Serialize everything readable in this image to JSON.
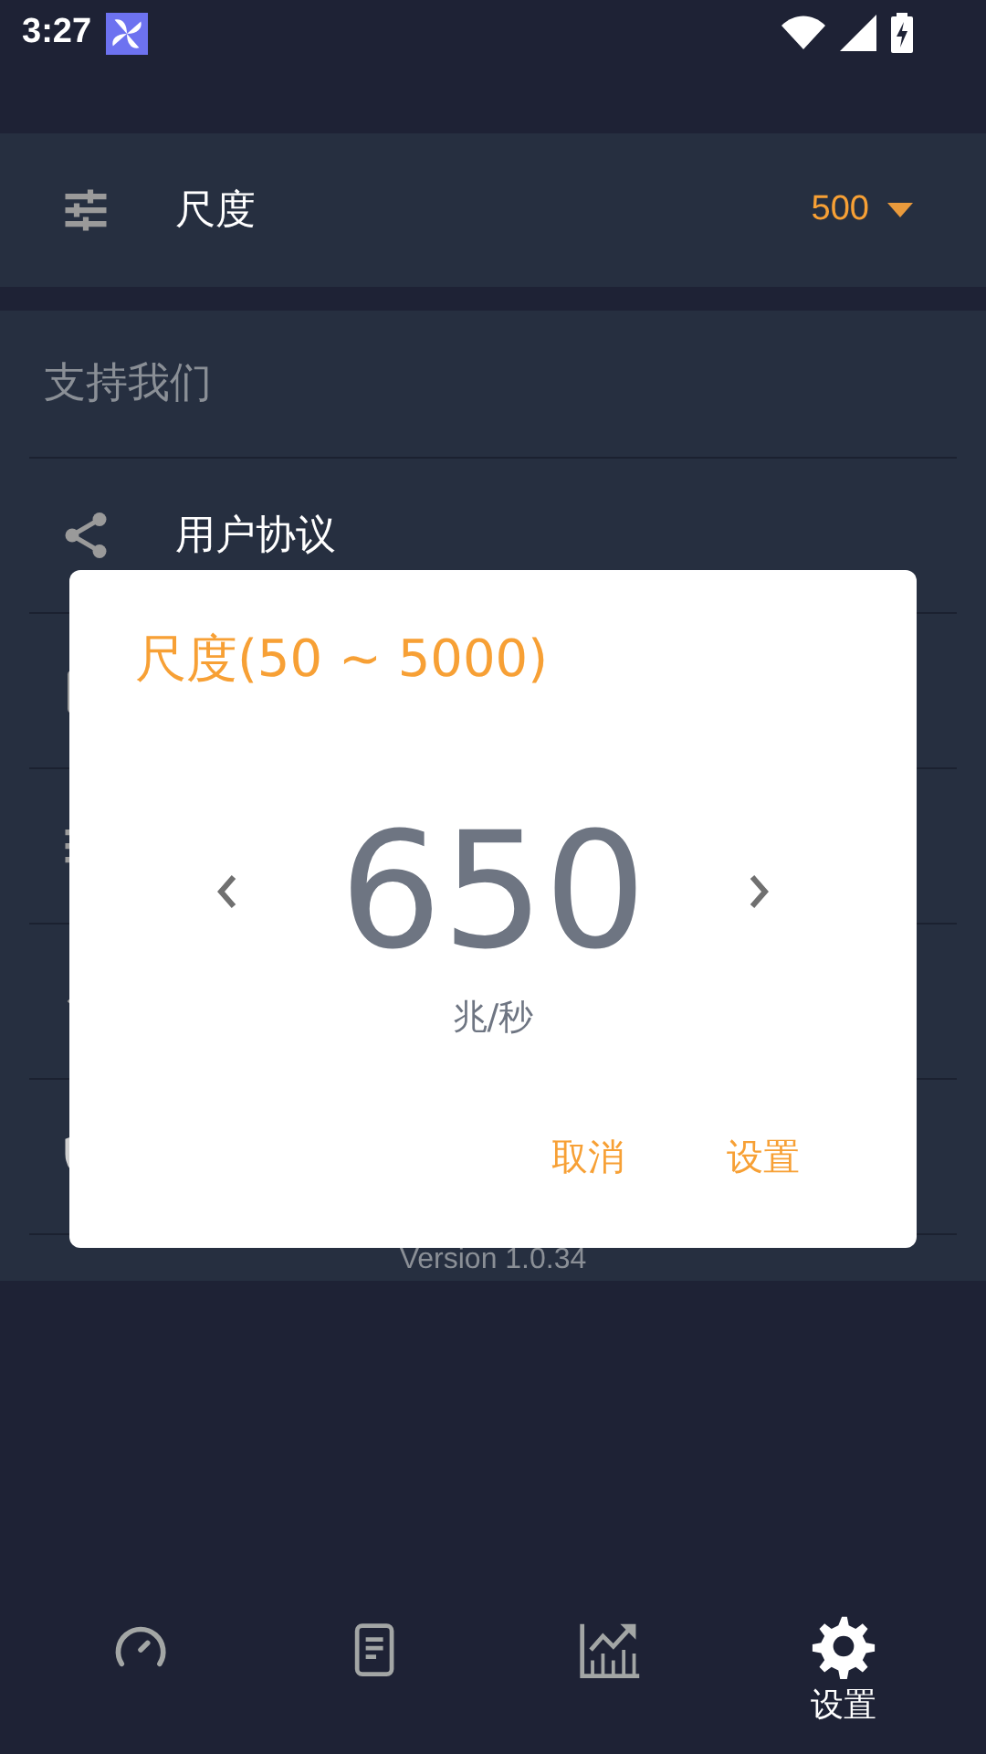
{
  "status_bar": {
    "time": "3:27"
  },
  "scale_setting": {
    "label": "尺度",
    "value": "500"
  },
  "support_section": {
    "header": "支持我们",
    "items": [
      {
        "label": "用户协议"
      }
    ]
  },
  "version": "Version 1.0.34",
  "dialog": {
    "title": "尺度(50 ~ 5000)",
    "value": "650",
    "unit": "兆/秒",
    "buttons": [
      "取消",
      "设置"
    ]
  },
  "bottom_nav": [
    {
      "selected": false
    },
    {
      "selected": false
    },
    {
      "selected": false
    },
    {
      "label": "设置",
      "selected": true
    }
  ]
}
